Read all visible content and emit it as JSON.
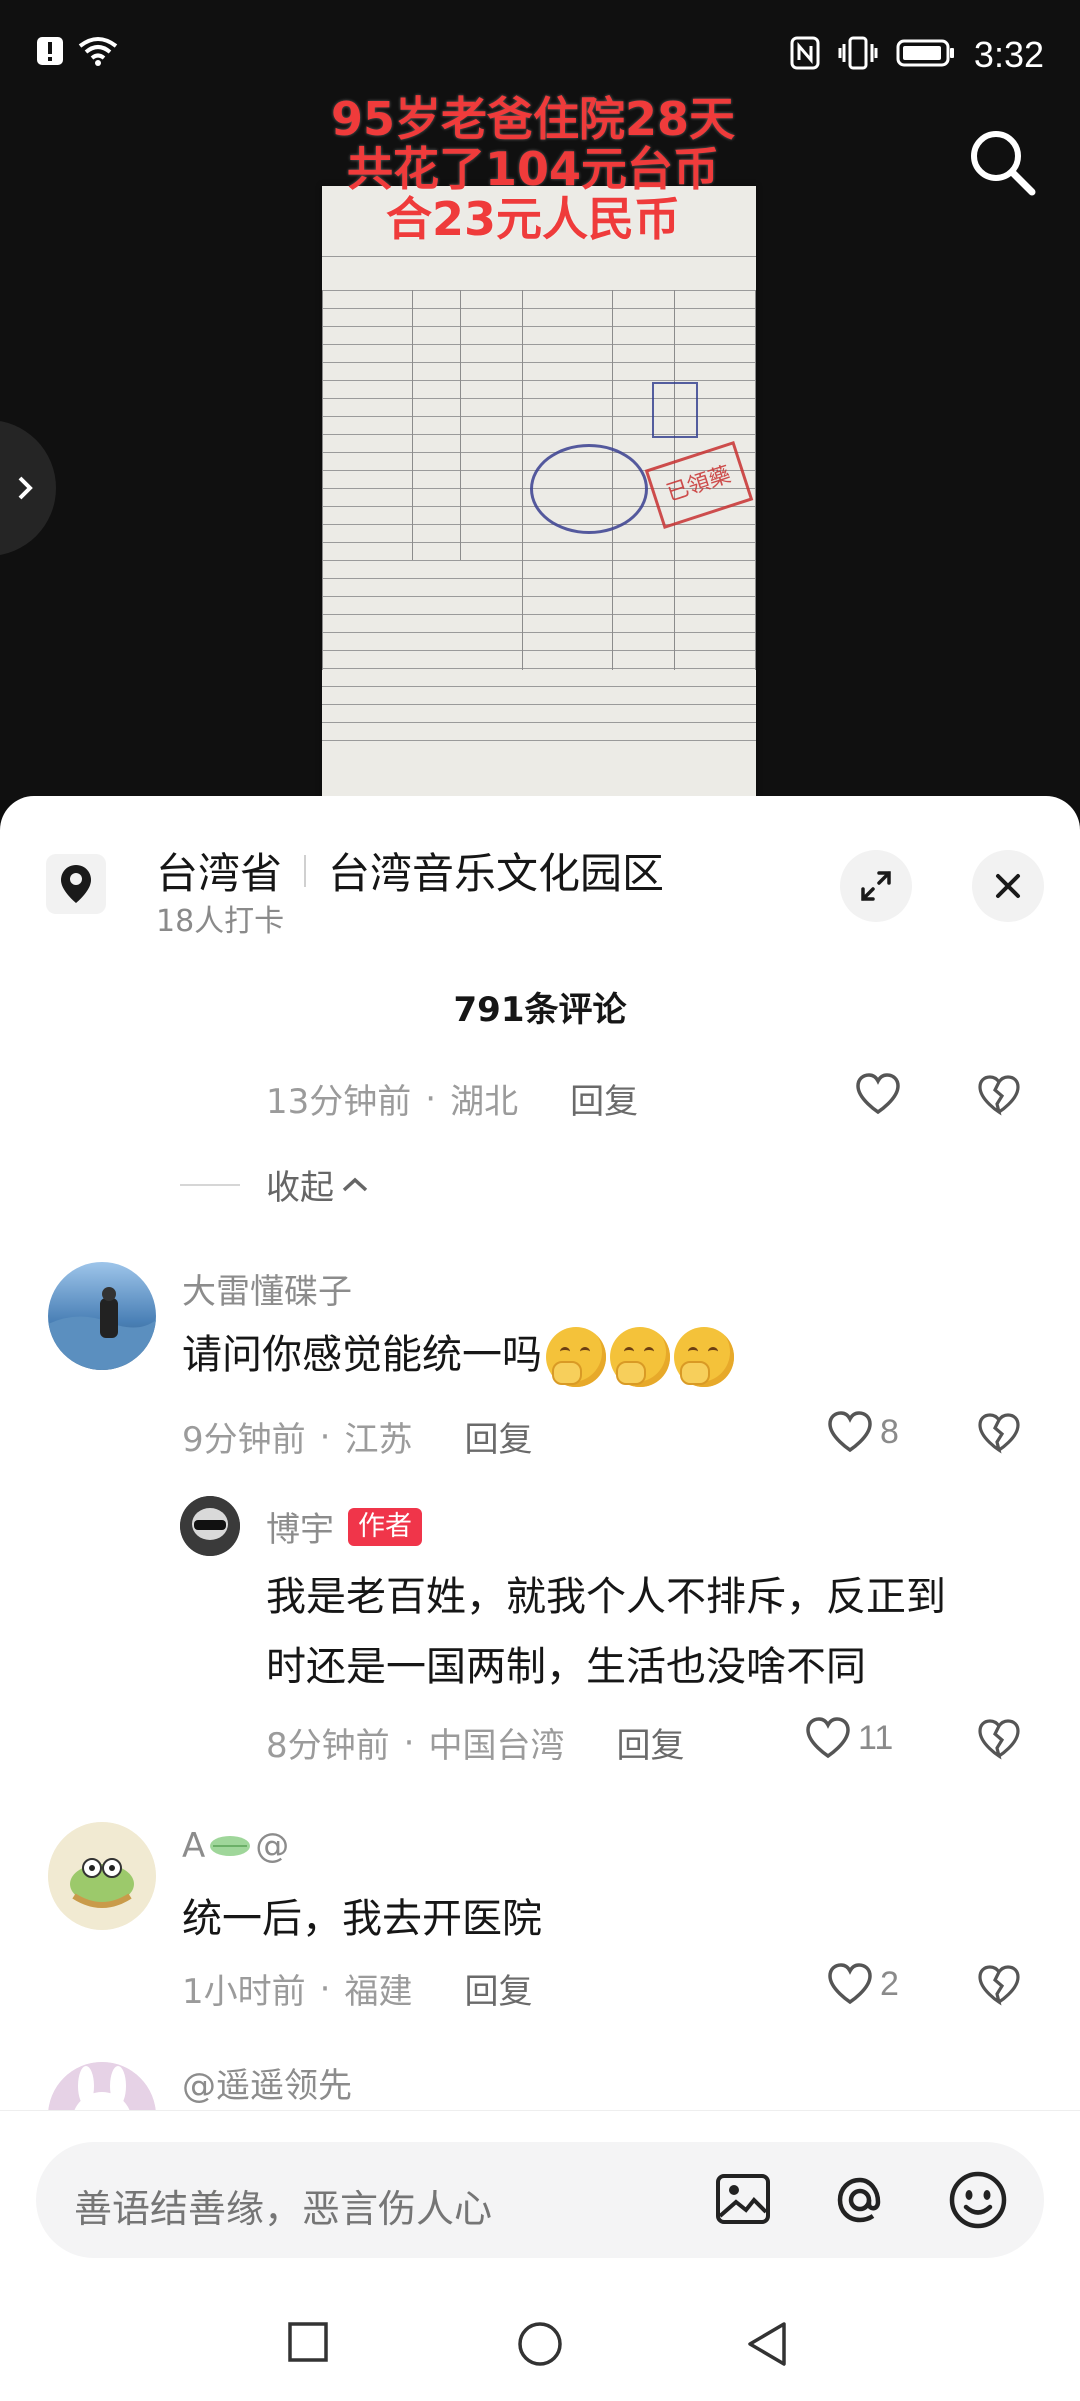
{
  "status_bar": {
    "time": "3:32"
  },
  "video": {
    "overlay_lines": [
      "95岁老爸住院28天",
      "共花了104元台币",
      "合23元人民币"
    ],
    "stamp_red": "已領藥"
  },
  "location": {
    "region": "台湾省",
    "place": "台湾音乐文化园区",
    "checkins": "18人打卡"
  },
  "comments_header": {
    "count_label": "791条评论"
  },
  "partial_reply": {
    "time": "13分钟前",
    "location": "湖北",
    "reply_label": "回复"
  },
  "collapse_label": "收起",
  "comments": [
    {
      "user": "大雷懂碟子",
      "text": "请问你感觉能统一吗",
      "emoji_count": 3,
      "time": "9分钟前",
      "location": "江苏",
      "reply_label": "回复",
      "likes": "8"
    },
    {
      "user": "博宇",
      "tag": "作者",
      "text_line1": "我是老百姓，就我个人不排斥，反正到",
      "text_line2": "时还是一国两制，生活也没啥不同",
      "time": "8分钟前",
      "location": "中国台湾",
      "reply_label": "回复",
      "likes": "11"
    },
    {
      "user": "A",
      "user_suffix": "@",
      "text": "统一后，我去开医院",
      "time": "1小时前",
      "location": "福建",
      "reply_label": "回复",
      "likes": "2"
    },
    {
      "user": "@遥遥领先"
    }
  ],
  "input": {
    "placeholder": "善语结善缘，恶言伤人心"
  },
  "icons": [
    "alert-icon",
    "wifi-icon",
    "nfc-icon",
    "vibrate-icon",
    "battery-icon",
    "search-icon",
    "chevron-right-icon",
    "location-pin-icon",
    "expand-icon",
    "close-icon",
    "heart-icon",
    "broken-heart-icon",
    "chevron-up-icon",
    "image-icon",
    "at-icon",
    "emoji-icon",
    "square-nav-icon",
    "circle-nav-icon",
    "triangle-back-icon"
  ],
  "colors": {
    "accent_red": "#f0354a",
    "overlay_red": "#ef3b3b"
  }
}
